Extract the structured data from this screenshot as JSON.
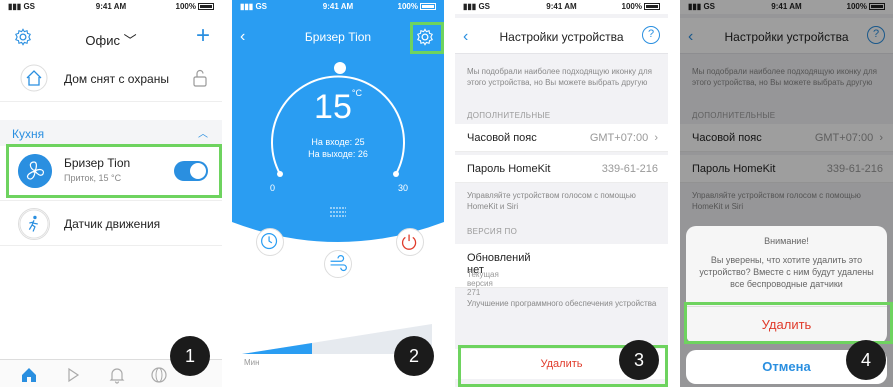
{
  "status": {
    "carrier": "GS",
    "time": "9:41 AM",
    "battery": "100%"
  },
  "screen1": {
    "location": "Офис",
    "security_label": "Дом снят с охраны",
    "room_name": "Кухня",
    "breezer_name": "Бризер Tion",
    "breezer_sub": "Приток, 15 °C",
    "breezer_on": true,
    "motion_label": "Датчик движения",
    "tabs": [
      "home-icon",
      "play-icon",
      "bell-icon",
      "globe-icon",
      "more-icon"
    ],
    "step": "1"
  },
  "screen2": {
    "title": "Бризер Tion",
    "temperature": "15",
    "unit": "°C",
    "inside": "На входе: 25",
    "outside": "На выходе: 26",
    "dial_min": "0",
    "dial_max": "30",
    "speed_label": "Мин",
    "step": "2"
  },
  "screen3": {
    "title": "Настройки устройства",
    "help": "?",
    "icon_note": "Мы подобрали наиболее подходящую иконку для этого устройства, но Вы можете выбрать другую",
    "section_extra": "ДОПОЛНИТЕЛЬНЫЕ",
    "timezone_label": "Часовой пояс",
    "timezone_value": "GMT+07:00",
    "homekit_label": "Пароль HomeKit",
    "homekit_value": "339-61-216",
    "homekit_note": "Управляйте устройством голосом с помощью HomeKit и Siri",
    "section_fw": "ВЕРСИЯ ПО",
    "update_title": "Обновлений нет",
    "update_sub": "Текущая версия 271",
    "fw_note": "Улучшение программного обеспечения устройства",
    "delete_label": "Удалить",
    "step": "3"
  },
  "screen4": {
    "alert_title": "Внимание!",
    "alert_message": "Вы уверены, что хотите удалить это устройство? Вместе с ним будут удалены все беспроводные датчики",
    "delete_label": "Удалить",
    "cancel_label": "Отмена",
    "step": "4"
  },
  "colors": {
    "accent": "#2a8fe0",
    "brand_blue": "#2a9df2",
    "highlight": "#6ed35f",
    "danger": "#e03b2b"
  }
}
